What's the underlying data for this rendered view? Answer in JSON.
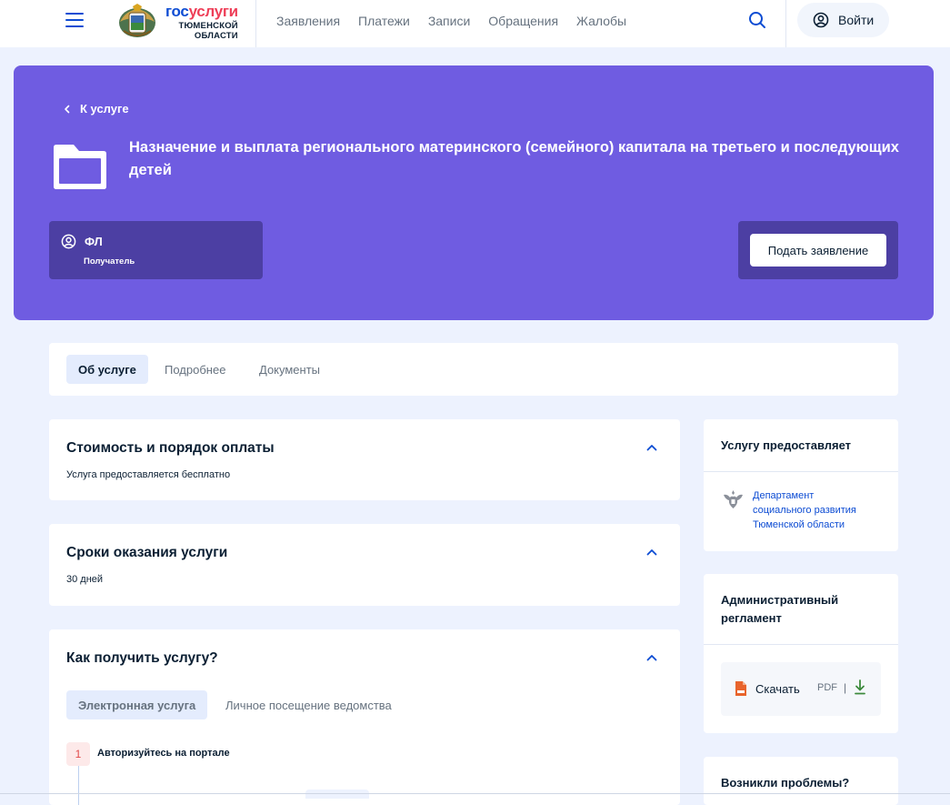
{
  "header": {
    "logo": {
      "gos": "гос",
      "uslugi": "услуги",
      "line2": "ТЮМЕНСКОЙ",
      "line3": "ОБЛАСТИ"
    },
    "nav": [
      "Заявления",
      "Платежи",
      "Записи",
      "Обращения",
      "Жалобы"
    ],
    "login_label": "Войти"
  },
  "hero": {
    "back_label": "К услуге",
    "title": "Назначение и выплата регионального материнского (семейного) капитала на третьего и последующих детей",
    "recipient_type": "ФЛ",
    "recipient_label": "Получатель",
    "apply_label": "Подать заявление"
  },
  "tabs": [
    "Об услуге",
    "Подробнее",
    "Документы"
  ],
  "cost": {
    "title": "Стоимость и порядок оплаты",
    "text": "Услуга предоставляется бесплатно"
  },
  "terms": {
    "title": "Сроки оказания услуги",
    "text": "30 дней"
  },
  "howto": {
    "title": "Как получить услугу?",
    "tabs": [
      "Электронная услуга",
      "Личное посещение ведомства"
    ],
    "step_number": "1",
    "step_text": "Авторизуйтесь на портале"
  },
  "provider": {
    "title": "Услугу предоставляет",
    "dept_line1": "Департамент",
    "dept_line2": "социального развития",
    "dept_line3": "Тюменской области"
  },
  "regulation": {
    "title_line1": "Административный",
    "title_line2": "регламент",
    "download_label": "Скачать",
    "format": "PDF",
    "separator": "|"
  },
  "problems": {
    "title": "Возникли проблемы?"
  },
  "colors": {
    "primary": "#0d4cd3",
    "hero_bg": "#6f5ce1",
    "hero_dark": "#4c3fa3",
    "page_bg": "#edf2fe",
    "accent_red": "#ee3f58",
    "download_green": "#3c8a3c"
  },
  "icons": {
    "menu": "burger-icon",
    "search": "search-icon",
    "user": "user-circle-icon",
    "back": "chevron-left-icon",
    "folder": "folder-icon",
    "collapse": "chevron-up-icon",
    "pdf": "pdf-file-icon",
    "download": "download-icon",
    "emblem": "coat-of-arms-icon"
  }
}
